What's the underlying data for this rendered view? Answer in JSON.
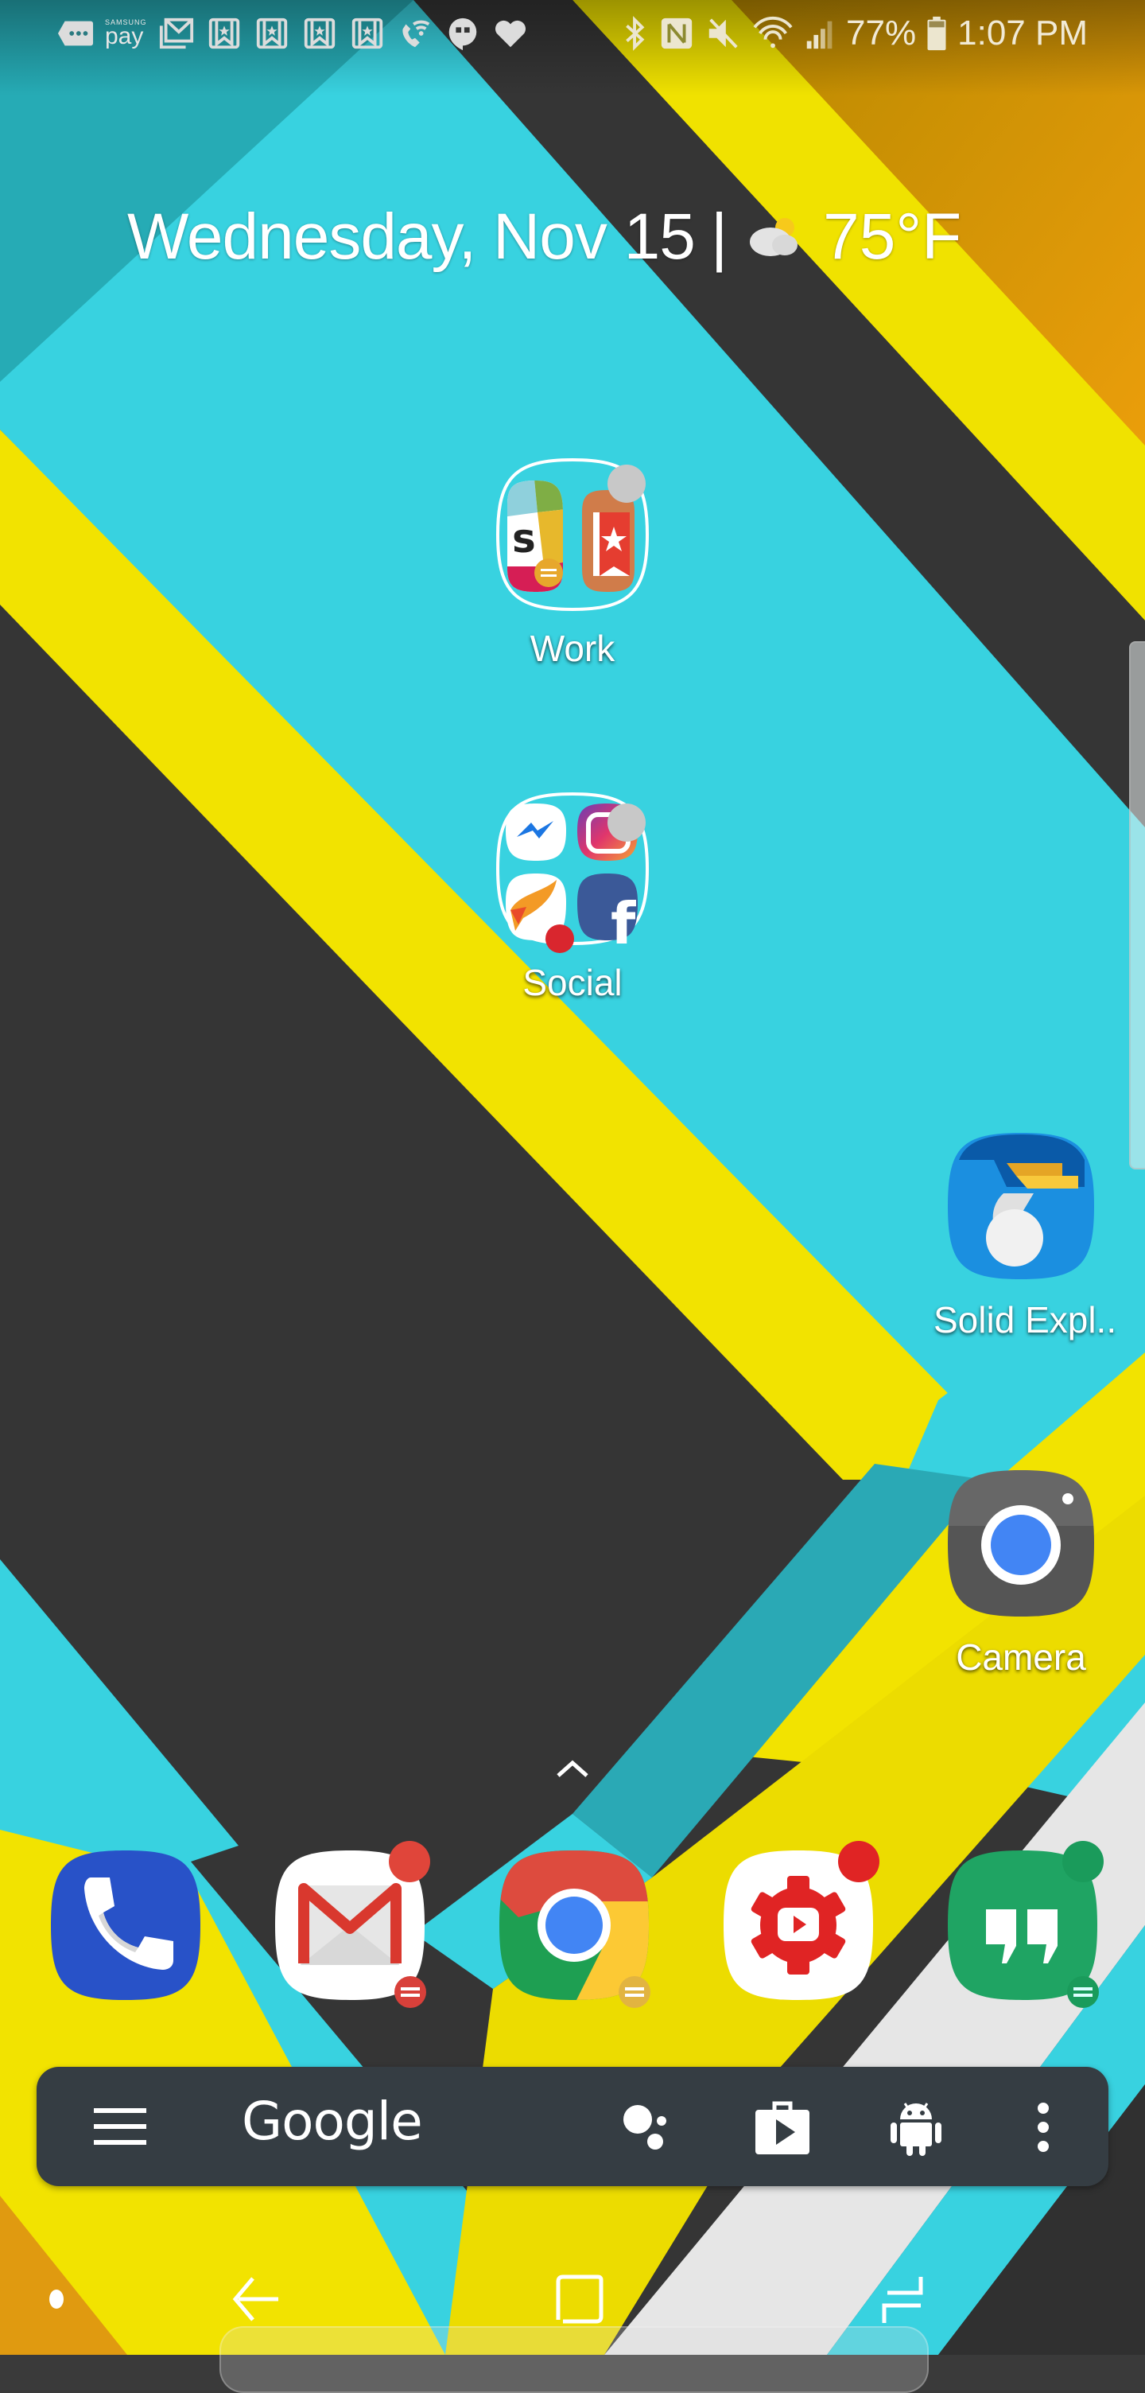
{
  "wallpaper": {
    "colors": {
      "cyan": "#37d3e2",
      "cyan_shadow": "#2bb0be",
      "dark": "#353535",
      "yellow": "#f3e500",
      "orange": "#e59a0c",
      "white": "#e9e9e9",
      "teal_top": "#1f8f97"
    }
  },
  "status_bar": {
    "left_icons": [
      "messages-icon",
      "samsung-pay-icon",
      "gmail-icon",
      "pocket-bookmark-icon",
      "pocket-bookmark-icon",
      "pocket-bookmark-icon",
      "pocket-bookmark-icon",
      "wifi-calling-icon",
      "hangouts-icon",
      "heart-icon"
    ],
    "samsung_pay_small": "SAMSUNG",
    "samsung_pay_big": "pay",
    "right_icons": [
      "bluetooth-icon",
      "nfc-icon",
      "mute-icon",
      "wifi-icon",
      "signal-icon"
    ],
    "battery_percent": "77%",
    "battery_level": 0.77,
    "time": "1:07 PM"
  },
  "widget": {
    "date": "Wednesday, Nov 15",
    "separator": "|",
    "weather_icon": "partly-cloudy-icon",
    "temperature": "75°F"
  },
  "home": {
    "folders": [
      {
        "label": "Work",
        "apps": [
          "Slack",
          "Wunderlist"
        ]
      },
      {
        "label": "Social",
        "apps": [
          "Messenger",
          "Instagram",
          "Bird app",
          "Facebook"
        ]
      }
    ],
    "apps": [
      {
        "label": "Solid Expl..",
        "icon": "solid-explorer-icon"
      },
      {
        "label": "Camera",
        "icon": "camera-icon"
      }
    ]
  },
  "dock": {
    "apps": [
      {
        "name": "Phone",
        "icon": "phone-icon",
        "badge": false
      },
      {
        "name": "Gmail",
        "icon": "gmail-icon",
        "badge": true,
        "badge_color": "#e0453a"
      },
      {
        "name": "Chrome",
        "icon": "chrome-icon",
        "badge": false
      },
      {
        "name": "YouTube Studio",
        "icon": "youtube-studio-icon",
        "badge": true,
        "badge_color": "#e02424"
      },
      {
        "name": "Hangouts",
        "icon": "hangouts-icon",
        "badge": true,
        "badge_color": "#1fa463"
      }
    ]
  },
  "search_bar": {
    "brand": "Google",
    "icons": [
      "menu-icon",
      "assistant-icon",
      "play-store-icon",
      "android-icon",
      "more-vert-icon"
    ],
    "background": "#353d43"
  },
  "nav_bar": {
    "buttons": [
      "dot-indicator",
      "back-button",
      "home-button",
      "recents-button"
    ]
  }
}
